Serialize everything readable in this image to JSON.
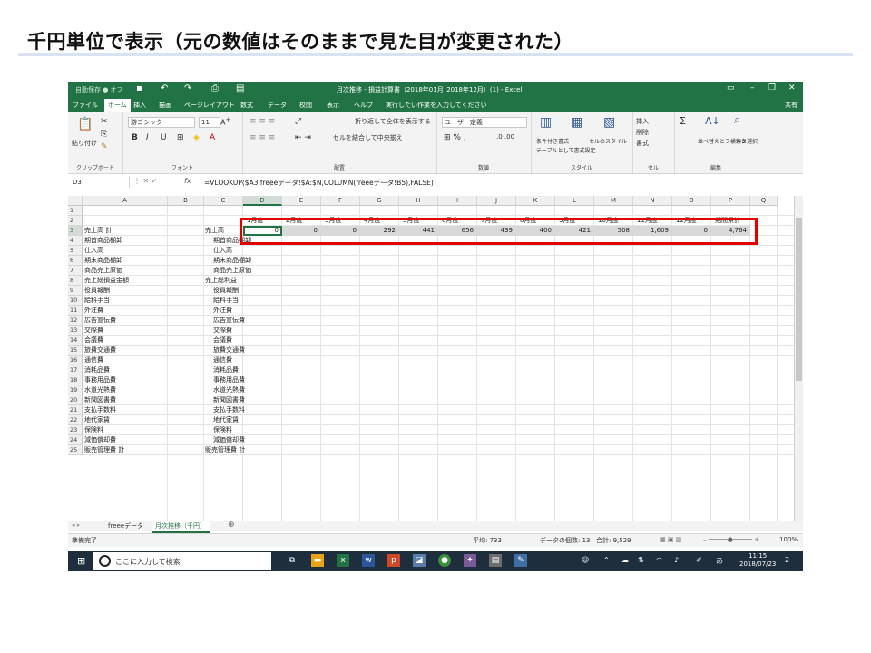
{
  "slide": {
    "title": "千円単位で表示（元の数値はそのままで見た目が変更された）"
  },
  "excel": {
    "title_bar": {
      "autosave": "自動保存 ● オフ",
      "document": "月次推移 - 損益計算書（2018年01月_2018年12月）(1) - Excel"
    },
    "tabs": [
      "ファイル",
      "ホーム",
      "挿入",
      "描画",
      "ページレイアウト",
      "数式",
      "データ",
      "校閲",
      "表示",
      "ヘルプ",
      "実行したい作業を入力してください"
    ],
    "active_tab": "ホーム",
    "share_label": "共有",
    "ribbon": {
      "clipboard": {
        "label": "クリップボード",
        "paste": "貼り付け"
      },
      "font": {
        "label": "フォント",
        "name": "游ゴシック",
        "size": "11"
      },
      "alignment": {
        "label": "配置",
        "wrap": "折り返して全体を表示する",
        "merge": "セルを結合して中央揃え"
      },
      "number": {
        "label": "数値",
        "format": "ユーザー定義"
      },
      "styles": {
        "label": "スタイル",
        "conditional": "条件付き書式",
        "table": "テーブルとして書式設定",
        "cell_style": "セルのスタイル"
      },
      "cells": {
        "label": "セル",
        "insert": "挿入",
        "delete": "削除",
        "format": "書式"
      },
      "editing": {
        "label": "編集",
        "sort": "並べ替えとフィルター",
        "find": "検索と選択"
      }
    },
    "formula_bar": {
      "name_box": "D3",
      "formula": "=VLOOKUP($A3,freeeデータ!$A:$N,COLUMN(freeeデータ!B5),FALSE)"
    },
    "columns": [
      "A",
      "B",
      "C",
      "D",
      "E",
      "F",
      "G",
      "H",
      "I",
      "J",
      "K",
      "L",
      "M",
      "N",
      "O",
      "P",
      "Q"
    ],
    "rows": [
      "1",
      "2",
      "3",
      "4",
      "5",
      "6",
      "7",
      "8",
      "9",
      "10",
      "11",
      "12",
      "13",
      "14",
      "15",
      "16",
      "17",
      "18",
      "19",
      "20",
      "21",
      "22",
      "23",
      "24",
      "25"
    ],
    "month_headers": [
      "1月度",
      "2月度",
      "3月度",
      "4月度",
      "5月度",
      "6月度",
      "7月度",
      "8月度",
      "9月度",
      "10月度",
      "11月度",
      "12月度",
      "期間累計"
    ],
    "sales_row_values": [
      "0",
      "0",
      "0",
      "292",
      "441",
      "656",
      "439",
      "400",
      "421",
      "508",
      "1,609",
      "0",
      "4,764"
    ],
    "column_a": [
      "売上高 計",
      "期首商品棚卸",
      "仕入高",
      "期末商品棚卸",
      "商品売上原価",
      "売上総損益金額",
      "役員報酬",
      "給料手当",
      "外注費",
      "広告宣伝費",
      "交際費",
      "会議費",
      "旅費交通費",
      "通信費",
      "消耗品費",
      "事務用品費",
      "水道光熱費",
      "新聞図書費",
      "支払手数料",
      "地代家賃",
      "保険料",
      "減価償却費",
      "販売管理費 計"
    ],
    "column_c": [
      "売上高",
      "期首商品棚卸",
      "仕入高",
      "期末商品棚卸",
      "商品売上原価",
      "売上総利益",
      "役員報酬",
      "給料手当",
      "外注費",
      "広告宣伝費",
      "交際費",
      "会議費",
      "旅費交通費",
      "通信費",
      "消耗品費",
      "事務用品費",
      "水道光熱費",
      "新聞図書費",
      "支払手数料",
      "地代家賃",
      "保険料",
      "減価償却費",
      "販売管理費 計"
    ],
    "sheet_tabs": [
      "freeeデータ",
      "月次推移（千円）"
    ],
    "active_sheet": "月次推移（千円）",
    "status": {
      "ready": "準備完了",
      "average": "平均: 733",
      "count": "データの個数: 13",
      "sum": "合計: 9,529",
      "zoom": "100%"
    },
    "taskbar": {
      "search_placeholder": "ここに入力して検索",
      "time": "11:15",
      "date": "2018/07/23",
      "ime": "あ",
      "notif_count": "2"
    },
    "colors": {
      "excel_green": "#217346",
      "highlight_red": "#e00000",
      "band_gray": "#d8d8d8"
    }
  }
}
